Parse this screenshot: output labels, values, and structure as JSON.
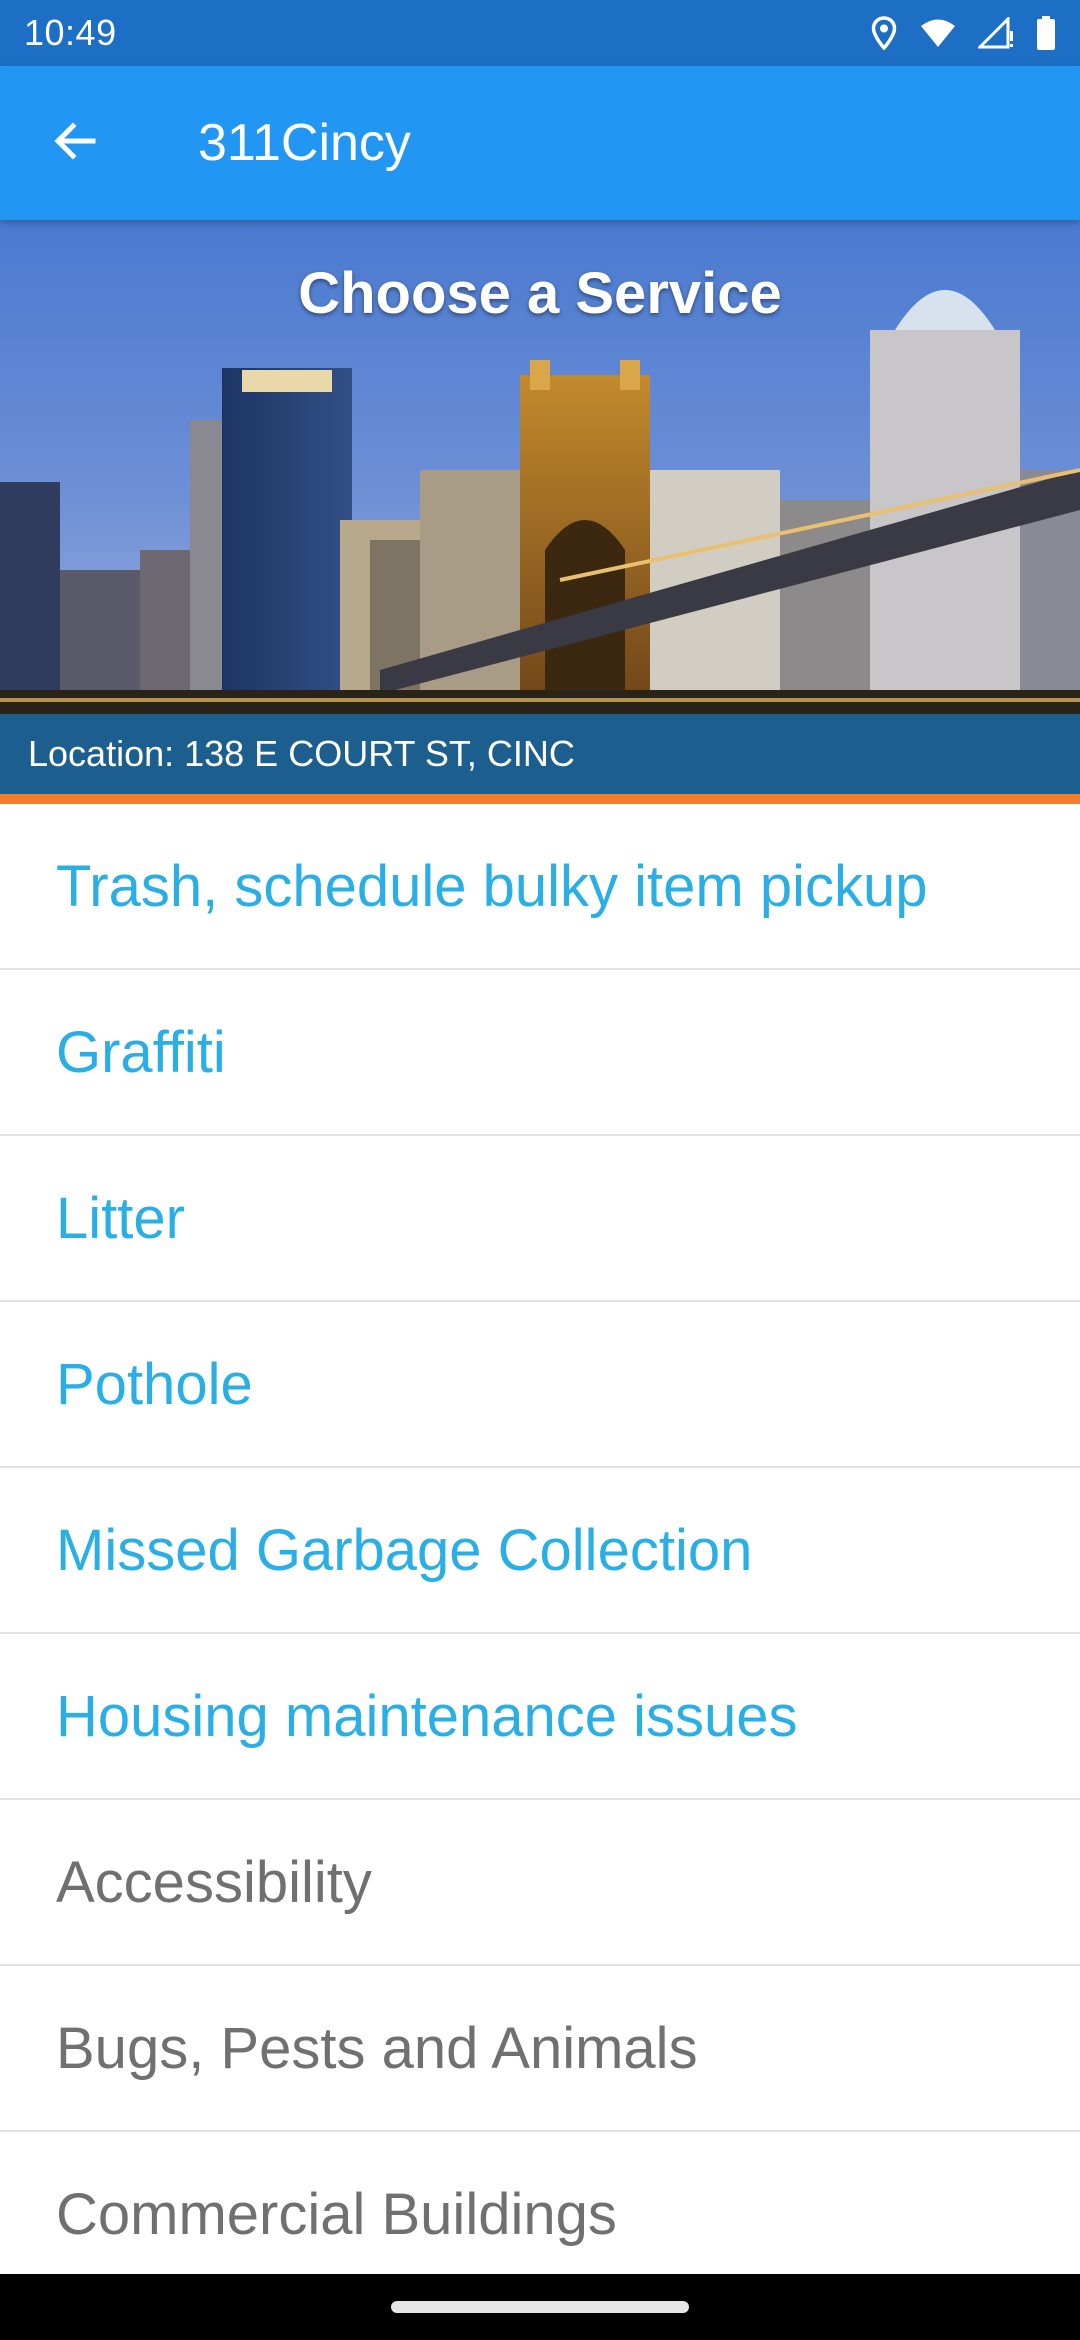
{
  "status_bar": {
    "time": "10:49",
    "icons": [
      "location-icon",
      "wifi-icon",
      "signal-icon",
      "battery-icon"
    ]
  },
  "app_bar": {
    "back_icon": "arrow-back-icon",
    "title": "311Cincy",
    "color": "#2196f3"
  },
  "hero": {
    "title": "Choose a Service",
    "image": "cincinnati-skyline-photo"
  },
  "location": {
    "text": "Location: 138 E COURT ST, CINC"
  },
  "services": [
    {
      "label": "Trash, schedule bulky item pickup",
      "state": "active"
    },
    {
      "label": "Graffiti",
      "state": "active"
    },
    {
      "label": "Litter",
      "state": "active"
    },
    {
      "label": "Pothole",
      "state": "active"
    },
    {
      "label": "Missed Garbage Collection",
      "state": "active"
    },
    {
      "label": "Housing maintenance issues",
      "state": "active"
    },
    {
      "label": "Accessibility",
      "state": "inactive"
    },
    {
      "label": "Bugs, Pests and Animals",
      "state": "inactive"
    },
    {
      "label": "Commercial Buildings",
      "state": "inactive"
    }
  ],
  "colors": {
    "status_bar": "#1c6fc4",
    "app_bar": "#2196f3",
    "location_bar": "#1c5f8e",
    "accent": "#f37c2a",
    "active_text": "#29aee5",
    "inactive_text": "#707070"
  }
}
